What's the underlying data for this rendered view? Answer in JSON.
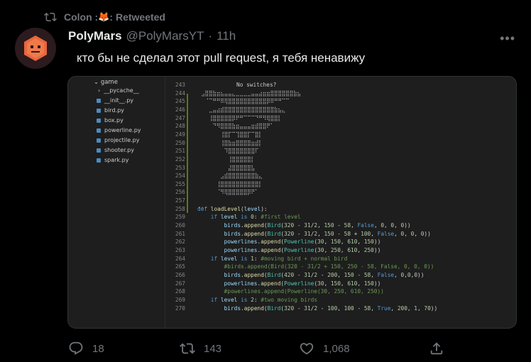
{
  "retweet": {
    "label": "Colon :",
    "emoji": "🦊",
    "suffix": ": Retweeted"
  },
  "tweet": {
    "name": "PolyMars",
    "handle": "@PolyMarsYT",
    "dot": "·",
    "time": "11h",
    "text": "кто бы не сделал этот pull request, я тебя ненавижу"
  },
  "explorer": {
    "folder": "game",
    "items": [
      {
        "label": "__pycache__",
        "icon": "chevron-right-icon"
      },
      {
        "label": "__init__.py",
        "icon": "python-icon"
      },
      {
        "label": "bird.py",
        "icon": "python-icon"
      },
      {
        "label": "box.py",
        "icon": "python-icon"
      },
      {
        "label": "powerline.py",
        "icon": "python-icon"
      },
      {
        "label": "projectile.py",
        "icon": "python-icon"
      },
      {
        "label": "shooter.py",
        "icon": "python-icon"
      },
      {
        "label": "spark.py",
        "icon": "python-icon"
      }
    ]
  },
  "code": {
    "line_numbers": [
      "243",
      "244",
      "245",
      "246",
      "247",
      "248",
      "249",
      "250",
      "251",
      "252",
      "253",
      "254",
      "255",
      "256",
      "257",
      "258",
      "259",
      "260",
      "261",
      "262",
      "263",
      "264",
      "265",
      "266",
      "267",
      "268",
      "269",
      "270"
    ],
    "art_title": "No switches?",
    "art_lines": [
      "⣠⣿⣿⣷⣶⣦⣤⣤⣄⣀⣀⣀⣀⣤⣤⣴⣶⣶⣿⣿⣿⣿⣿⣿⣷⣦",
      "⠀⠈⠉⠛⠛⠿⢿⣿⣿⣿⣿⣿⣿⣿⣿⣿⣿⡿⠿⠛⠛⠉⠉⠀",
      "⠀⠀⣀⣤⣴⣾⣿⣿⣿⣿⣿⣿⣿⣿⣿⣿⣿⣿⣿⣷⣦⣄",
      "⠀⠀⢸⣿⣿⣿⣿⣿⡿⠟⠛⠉⠉⠉⠙⠛⠻⢿⣿⣿⡇",
      "⠀⠀⠀⠙⠻⣿⣿⣿⣷⣶⣤⣤⣤⣶⣾⣿⣿⠟⠁",
      "⠀⠀⠀⠀⠀⢸⣿⡏⠉⢹⣿⣿⡏⠉⣿⡇",
      "⠀⠀⠀⠀⠀⢸⣿⣷⣶⣿⣿⣿⣿⣶⣾⡇",
      "⠀⠀⠀⠀⠀⠀⠹⣿⣿⣿⣿⣿⣿⣿⠏",
      "⠀⠀⠀⠀⠀⠀⠀⢸⣿⣿⣿⣿⣿⡇",
      "⠀⠀⠀⠀⠀⠀⠀⣼⣿⣿⣿⣿⣿⣧",
      "⠀⠀⠀⠀⠀⣠⣾⣿⣿⣿⣿⣿⣿⣿⣷⣄",
      "⠀⠀⠀⠀⢸⣿⣿⣿⣿⣿⣿⣿⣿⣿⣿⡇",
      "⠀⠀⠀⠀⠈⠻⢿⣿⣿⣿⣿⣿⡿⠟⠁"
    ],
    "ellipsis": "...",
    "lines": [
      "def loadLevel(level):",
      "    if level is 0: #first level",
      "        birds.append(Bird(320 - 31/2, 150 - 58, False, 0, 0, 0))",
      "        birds.append(Bird(320 - 31/2, 150 - 58 + 100, False, 0, 0, 0))",
      "        powerlines.append(Powerline(30, 150, 610, 150))",
      "        powerlines.append(Powerline(30, 250, 610, 250))",
      "    if level is 1: #moving bird + normal bird",
      "        #birds.append(Bird(320 - 31/2 + 150, 250 - 58, False, 0, 0, 0))",
      "        birds.append(Bird(420 - 31/2 - 200, 150 - 58, False, 0,0,0))",
      "        powerlines.append(Powerline(30, 150, 610, 150))",
      "        #powerlines.append(Powerline(30, 250, 610, 250))",
      "    if level is 2: #two moving birds",
      "        birds.append(Bird(320 - 31/2 - 100, 100 - 58, True, 200, 1, 70))"
    ]
  },
  "actions": {
    "reply_count": "18",
    "retweet_count": "143",
    "like_count": "1,068"
  },
  "colors": {
    "background": "#000000",
    "text": "#e7e9ea",
    "muted": "#71767b",
    "editor_bg": "#1e1e1e"
  }
}
